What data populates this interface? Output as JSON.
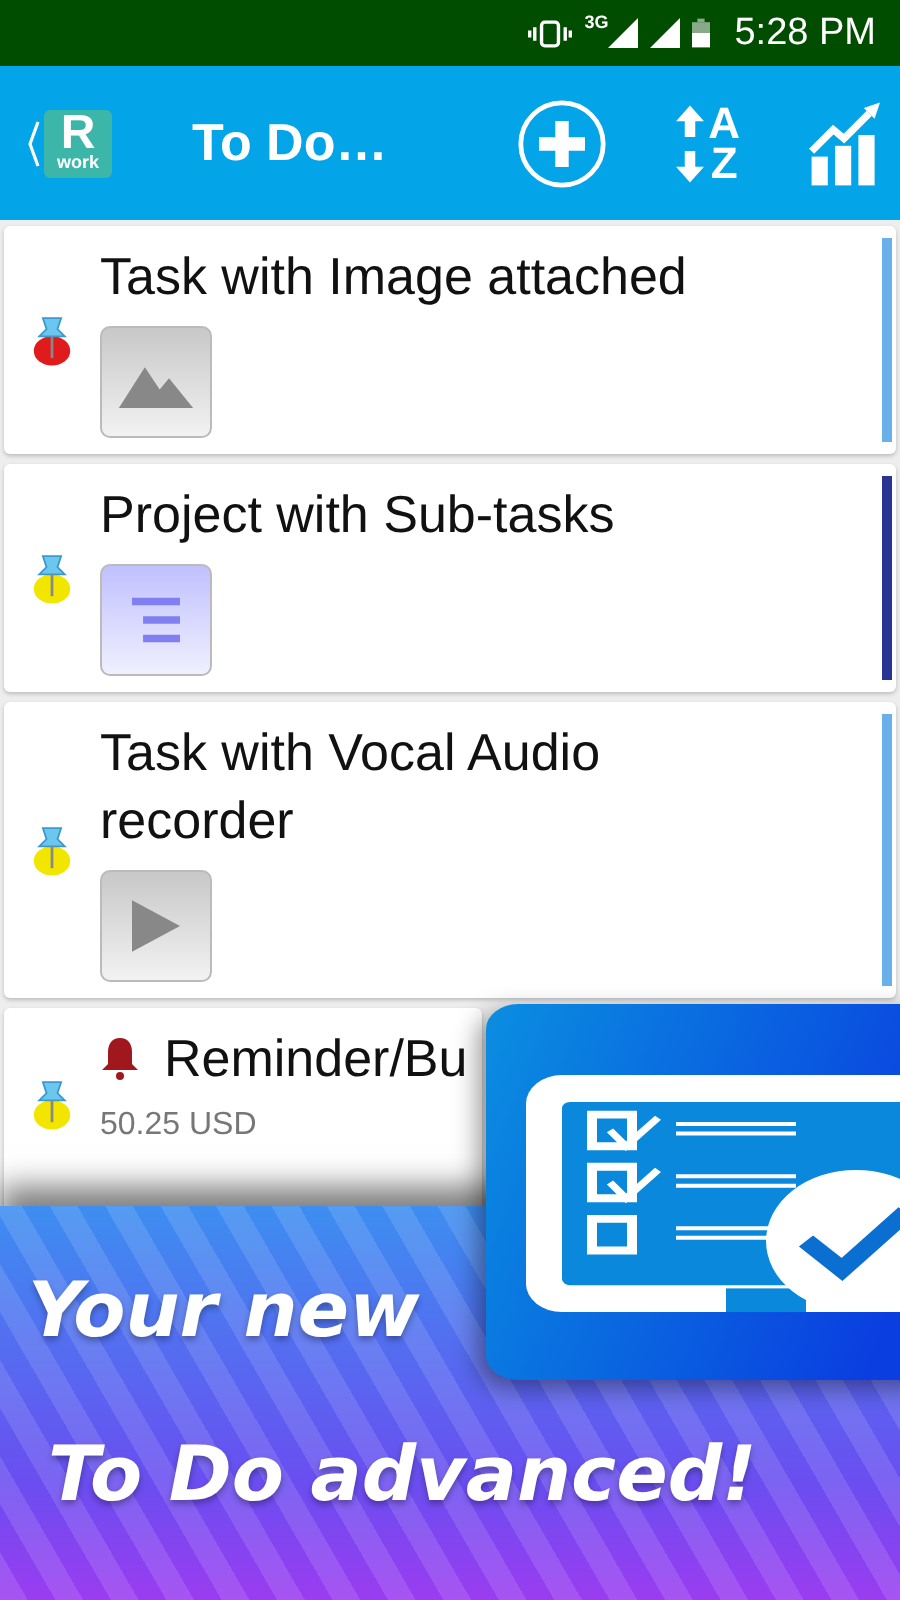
{
  "status_bar": {
    "network": "3G",
    "time": "5:28 PM"
  },
  "app_bar": {
    "logo_letter": "R",
    "logo_word": "work",
    "title": "To Do…",
    "sort_letters": [
      "A",
      "Z"
    ]
  },
  "tasks": [
    {
      "title": "Task with Image attached",
      "kind": "image",
      "pin": {
        "color": "#e01b1b"
      },
      "stripe": {
        "color": "#6ab0e8"
      }
    },
    {
      "title": "Project with Sub-tasks",
      "kind": "subtasks",
      "pin": {
        "color": "#f2e600"
      },
      "stripe": {
        "color": "#283593"
      }
    },
    {
      "title": "Task with Vocal Audio recorder",
      "kind": "audio",
      "pin": {
        "color": "#f2e600"
      },
      "stripe": {
        "color": "#6ab0e8"
      }
    },
    {
      "title": "Reminder/Bu",
      "kind": "reminder",
      "amount": "50.25 USD",
      "pin": {
        "color": "#f2e600"
      }
    }
  ],
  "promo": {
    "line_1": "Your new",
    "line_2": "To Do advanced!"
  }
}
